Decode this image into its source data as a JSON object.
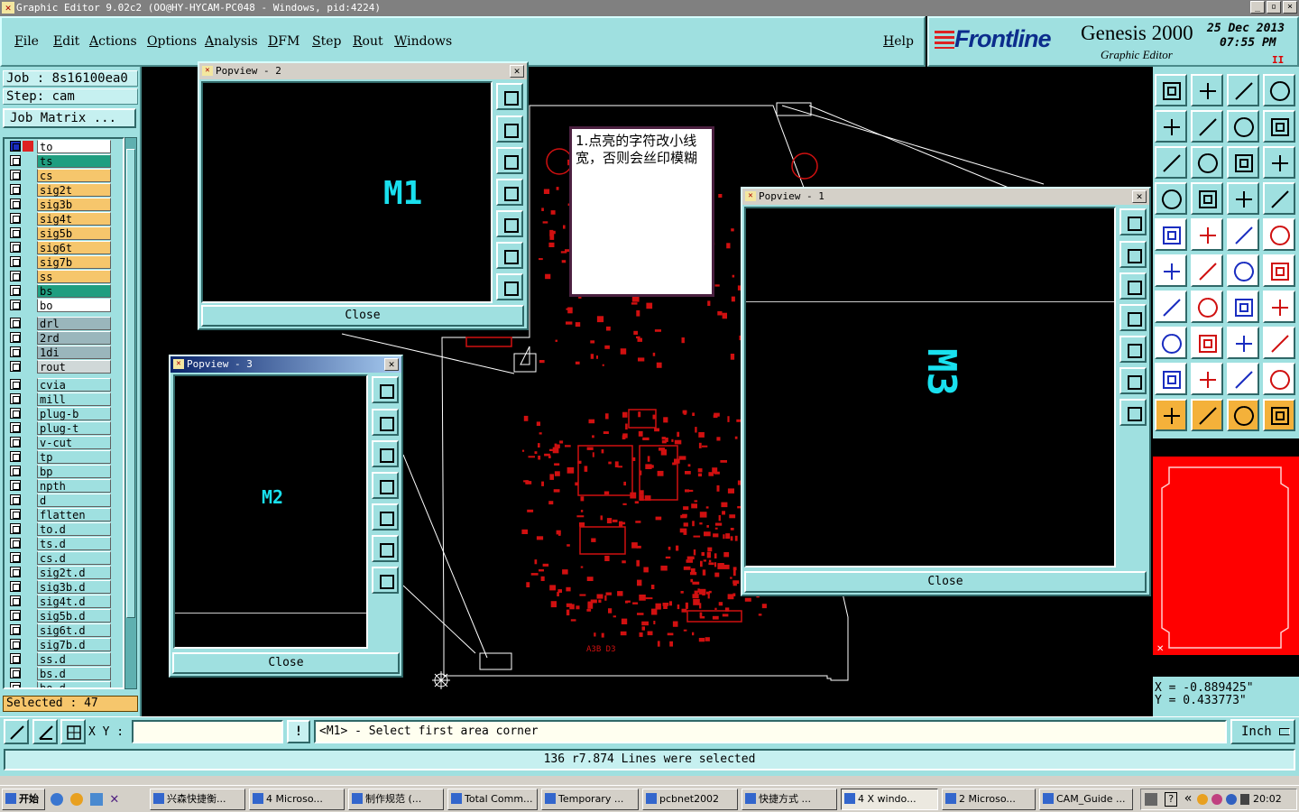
{
  "window": {
    "title": "Graphic Editor 9.02c2 (OO@HY-HYCAM-PC048 - Windows, pid:4224)",
    "controls": [
      "_",
      "▫",
      "×"
    ]
  },
  "menu": {
    "items": [
      "File",
      "Edit",
      "Actions",
      "Options",
      "Analysis",
      "DFM",
      "Step",
      "Rout",
      "Windows"
    ],
    "help": "Help"
  },
  "brand": {
    "logo_text": "Frontline",
    "product": "Genesis 2000",
    "subtitle": "Graphic Editor",
    "date": "25 Dec 2013",
    "time": "07:55 PM",
    "pause": "II"
  },
  "job": {
    "job_label": "Job : 8s16100ea0",
    "step_label": "Step: cam",
    "matrix_button": "Job Matrix ..."
  },
  "layers": [
    {
      "name": "to",
      "color": "#ffffff",
      "work": true
    },
    {
      "name": "ts",
      "color": "#1f9e80"
    },
    {
      "name": "cs",
      "color": "#f6c66c"
    },
    {
      "name": "sig2t",
      "color": "#f6c66c"
    },
    {
      "name": "sig3b",
      "color": "#f6c66c"
    },
    {
      "name": "sig4t",
      "color": "#f6c66c"
    },
    {
      "name": "sig5b",
      "color": "#f6c66c"
    },
    {
      "name": "sig6t",
      "color": "#f6c66c"
    },
    {
      "name": "sig7b",
      "color": "#f6c66c"
    },
    {
      "name": "ss",
      "color": "#f6c66c"
    },
    {
      "name": "bs",
      "color": "#1f9e80"
    },
    {
      "name": "bo",
      "color": "#ffffff",
      "sep_after": true
    },
    {
      "name": "drl",
      "color": "#9ab6bc"
    },
    {
      "name": "2rd",
      "color": "#9ab6bc"
    },
    {
      "name": "1di",
      "color": "#9ab6bc"
    },
    {
      "name": "rout",
      "color": "#d0d8d8",
      "sep_after": true
    },
    {
      "name": "cvia",
      "color": "#9fe0e0"
    },
    {
      "name": "mill",
      "color": "#9fe0e0"
    },
    {
      "name": "plug-b",
      "color": "#9fe0e0"
    },
    {
      "name": "plug-t",
      "color": "#9fe0e0"
    },
    {
      "name": "v-cut",
      "color": "#9fe0e0"
    },
    {
      "name": "tp",
      "color": "#9fe0e0"
    },
    {
      "name": "bp",
      "color": "#9fe0e0"
    },
    {
      "name": "npth",
      "color": "#9fe0e0"
    },
    {
      "name": "d",
      "color": "#9fe0e0"
    },
    {
      "name": "flatten",
      "color": "#9fe0e0"
    },
    {
      "name": "to.d",
      "color": "#9fe0e0"
    },
    {
      "name": "ts.d",
      "color": "#9fe0e0"
    },
    {
      "name": "cs.d",
      "color": "#9fe0e0"
    },
    {
      "name": "sig2t.d",
      "color": "#9fe0e0"
    },
    {
      "name": "sig3b.d",
      "color": "#9fe0e0"
    },
    {
      "name": "sig4t.d",
      "color": "#9fe0e0"
    },
    {
      "name": "sig5b.d",
      "color": "#9fe0e0"
    },
    {
      "name": "sig6t.d",
      "color": "#9fe0e0"
    },
    {
      "name": "sig7b.d",
      "color": "#9fe0e0"
    },
    {
      "name": "ss.d",
      "color": "#9fe0e0"
    },
    {
      "name": "bs.d",
      "color": "#9fe0e0"
    },
    {
      "name": "bo.d",
      "color": "#9fe0e0"
    }
  ],
  "selected_count": "Selected : 47",
  "popviews": {
    "p2": {
      "title": "Popview - 2",
      "label": "M1",
      "close": "Close"
    },
    "p3": {
      "title": "Popview - 3",
      "label": "M2",
      "close": "Close"
    },
    "p1": {
      "title": "Popview - 1",
      "label": "M3",
      "close": "Close"
    }
  },
  "note": "1.点亮的字符改小线宽，否则会丝印模糊",
  "board_text": "A3B D3",
  "coords": {
    "x": "X = -0.889425\"",
    "y": "Y = 0.433773\""
  },
  "command": {
    "xy_label": "X Y :",
    "xy_value": "",
    "prompt": "<M1> - Select first area corner",
    "units": "Inch",
    "info_mark": "!"
  },
  "status": "136 r7.874 Lines were selected",
  "taskbar": {
    "start": "开始",
    "tasks": [
      "兴森快捷衡...",
      "4 Microso...",
      "制作规范 (...",
      "Total Comm...",
      "Temporary ...",
      "pcbnet2002",
      "快捷方式 ...",
      "4 X windo...",
      "2 Microso...",
      "CAM_Guide ..."
    ],
    "clock": "20:02"
  },
  "colors": {
    "panel": "#9fe0e0",
    "board": "#d01010",
    "outline": "#ffffff",
    "label": "#19e0ee",
    "selected": "#f6c66c"
  }
}
